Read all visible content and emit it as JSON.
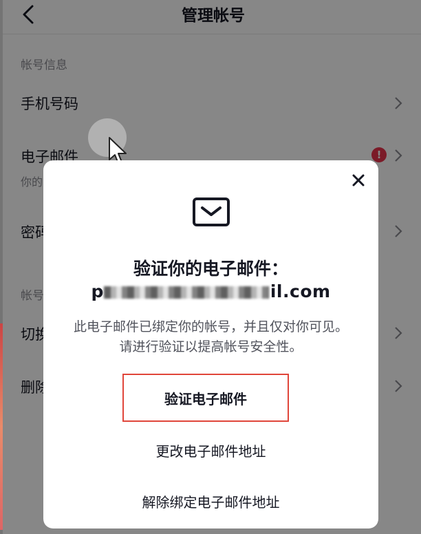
{
  "header": {
    "title": "管理帐号"
  },
  "sections": {
    "account_info": "帐号信息",
    "account_truncated": "帐号"
  },
  "rows": {
    "phone": "手机号码",
    "email": "电子邮件",
    "email_sub": "你的",
    "password": "密码",
    "switch": "切换",
    "delete": "删除"
  },
  "badge": {
    "warning": "!"
  },
  "modal": {
    "title": "验证你的电子邮件：",
    "email_prefix": "p",
    "email_suffix": "il.com",
    "description": "此电子邮件已绑定你的帐号，并且仅对你可见。请进行验证以提高帐号安全性。",
    "verify_button": "验证电子邮件",
    "change_link": "更改电子邮件地址",
    "unbind_link": "解除绑定电子邮件地址"
  },
  "colors": {
    "warning": "#e8344c",
    "highlight_border": "#e0453a",
    "overlay": "rgba(0,0,0,0.47)"
  }
}
